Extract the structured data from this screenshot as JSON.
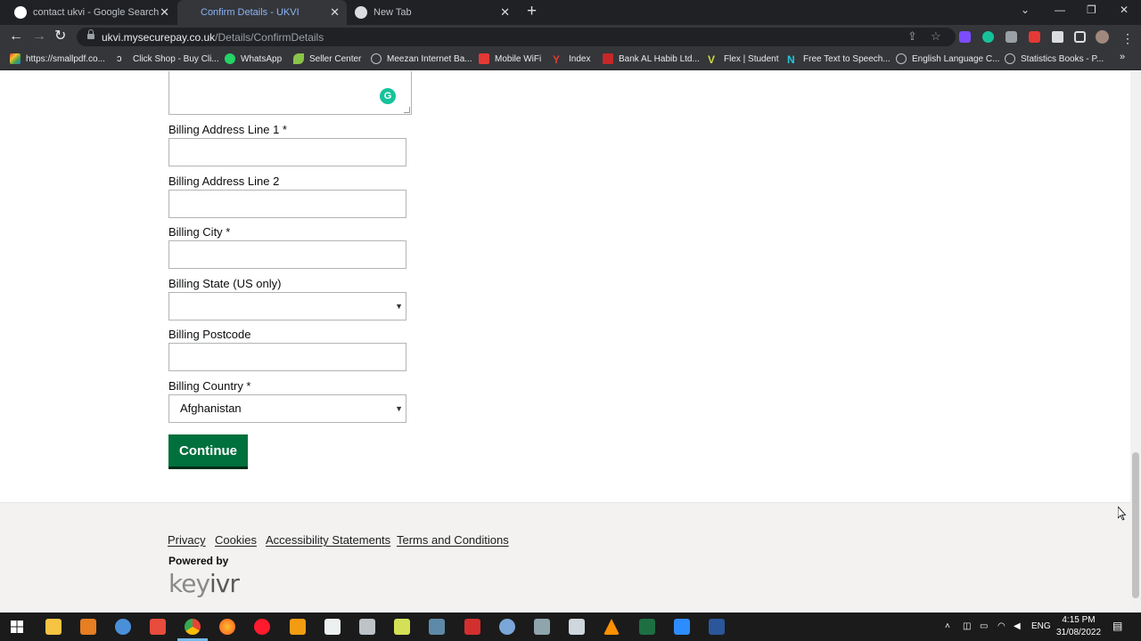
{
  "browser": {
    "tabs": [
      {
        "title": "contact ukvi - Google Search",
        "active": false
      },
      {
        "title": "Confirm Details - UKVI",
        "active": true
      },
      {
        "title": "New Tab",
        "active": false
      }
    ],
    "url_host": "ukvi.mysecurepay.co.uk",
    "url_path": "/Details/ConfirmDetails",
    "bookmarks": [
      "https://smallpdf.co...",
      "Click Shop - Buy Cli...",
      "WhatsApp",
      "Seller Center",
      "Meezan Internet Ba...",
      "Mobile WiFi",
      "Index",
      "Bank AL Habib Ltd...",
      "Flex | Student",
      "Free Text to Speech...",
      "English Language C...",
      "Statistics Books - P..."
    ]
  },
  "form": {
    "fields": [
      {
        "label": "Billing Address Line 1 *",
        "type": "input",
        "value": ""
      },
      {
        "label": "Billing Address Line 2",
        "type": "input",
        "value": ""
      },
      {
        "label": "Billing City *",
        "type": "input",
        "value": ""
      },
      {
        "label": "Billing State (US only)",
        "type": "select",
        "value": ""
      },
      {
        "label": "Billing Postcode",
        "type": "input",
        "value": ""
      },
      {
        "label": "Billing Country *",
        "type": "select",
        "value": "Afghanistan"
      }
    ],
    "continue_label": "Continue"
  },
  "footer": {
    "links": [
      "Privacy",
      "Cookies",
      "Accessibility Statements",
      "Terms and Conditions"
    ],
    "powered_by": "Powered by",
    "logo_key": "key",
    "logo_ivr": "ivr"
  },
  "taskbar": {
    "language": "ENG",
    "time": "4:15 PM",
    "date": "31/08/2022"
  },
  "colors": {
    "continue_button": "#00703c",
    "footer_bg": "#f3f2f1",
    "chrome_dark": "#202124"
  }
}
